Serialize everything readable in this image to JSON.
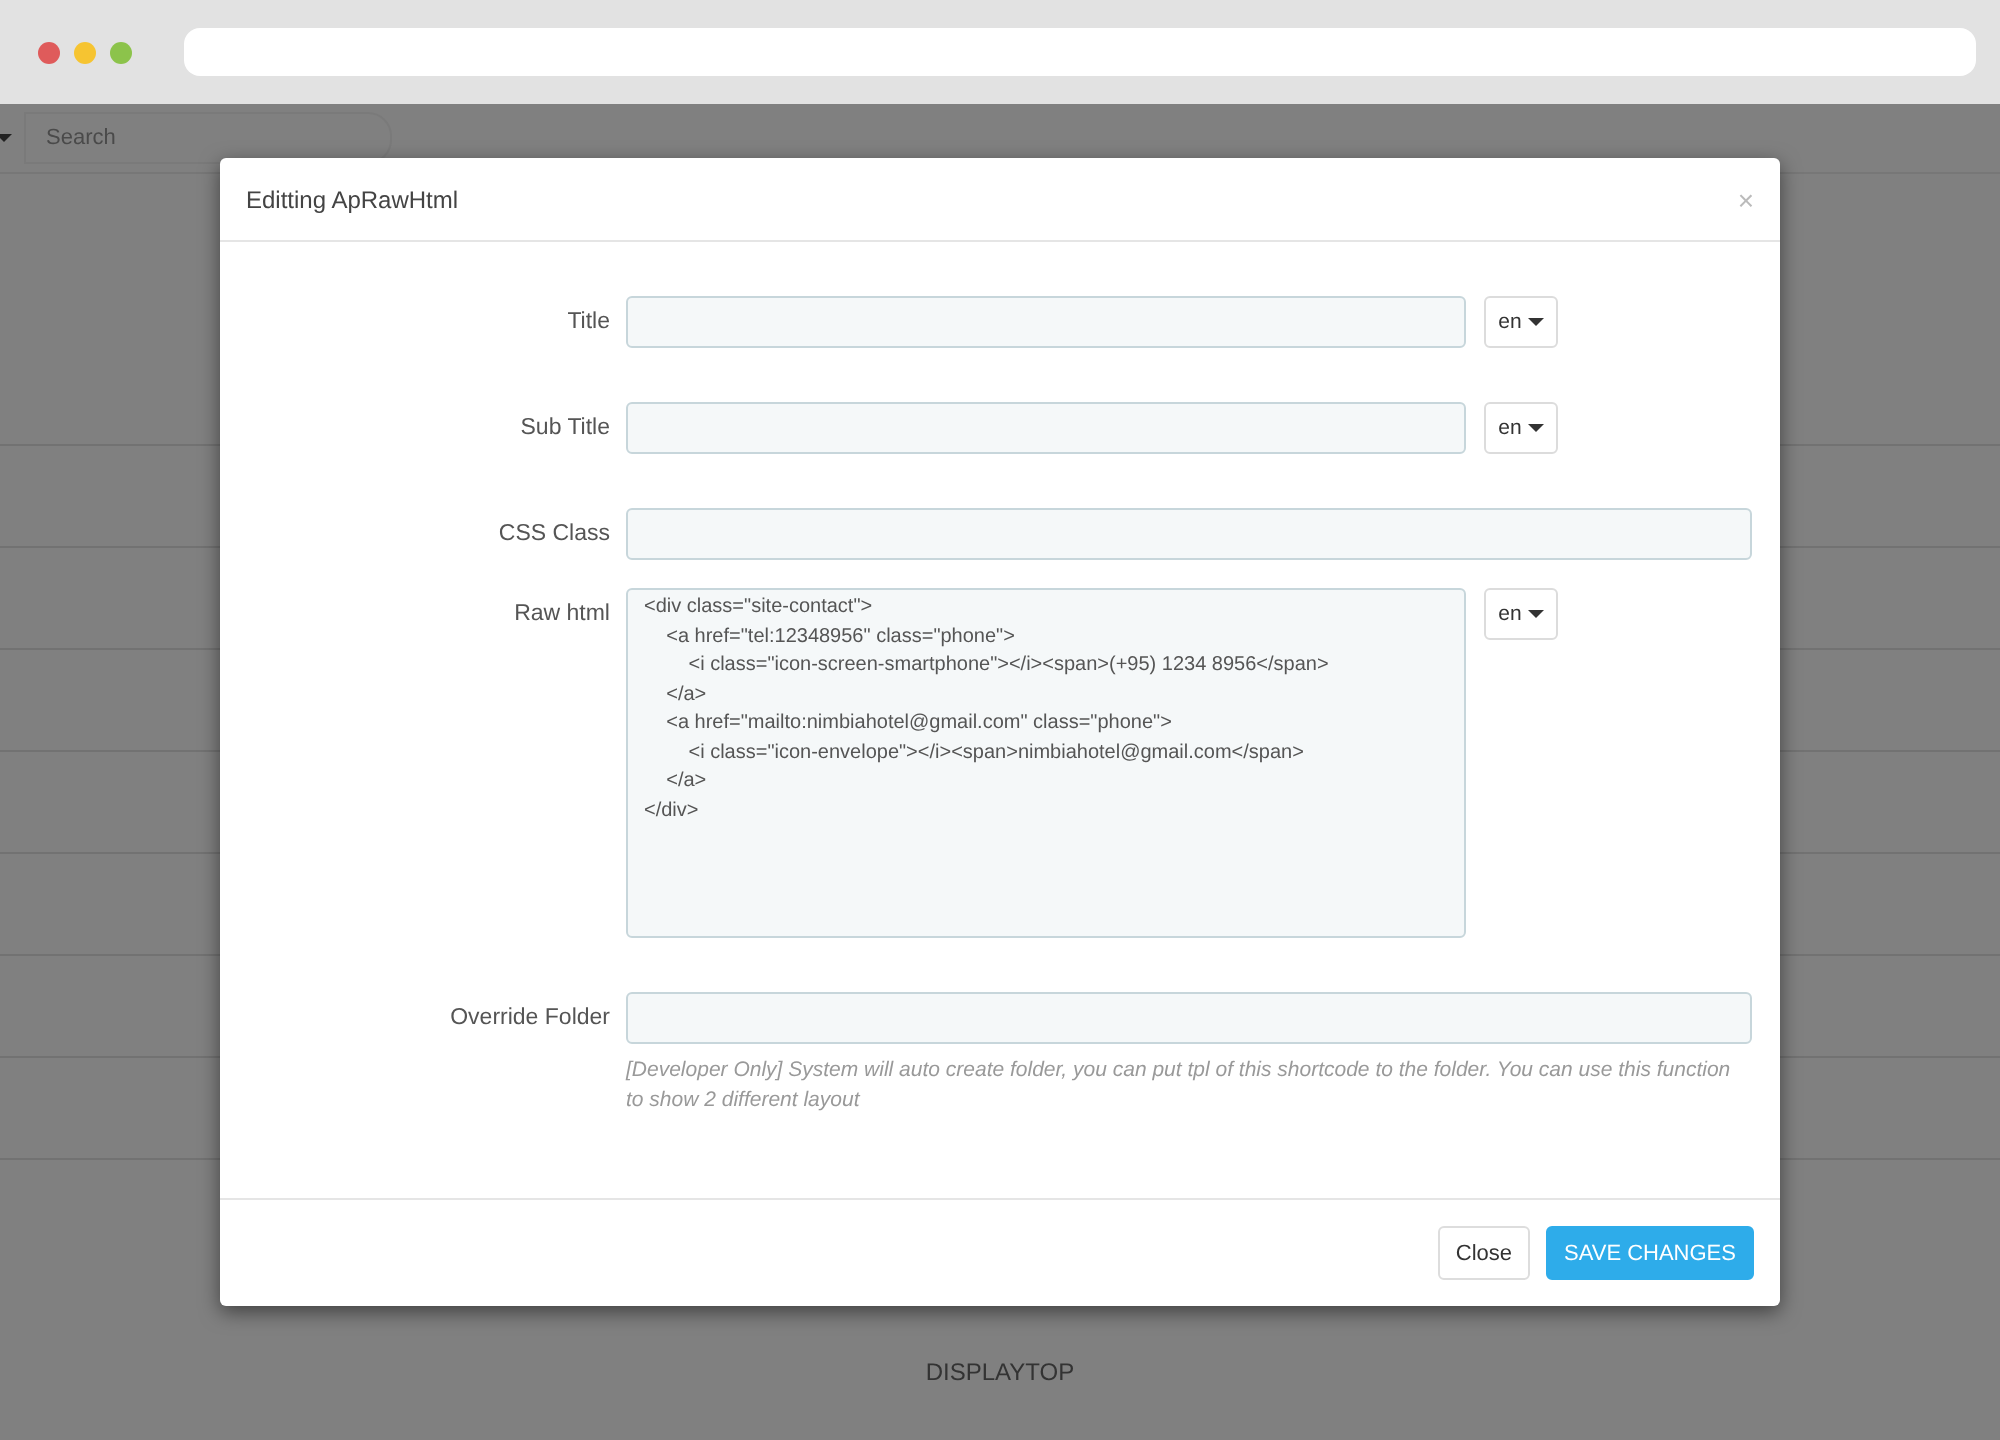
{
  "background": {
    "search": {
      "placeholder": "Search"
    },
    "section_label": "DISPLAYTOP"
  },
  "modal": {
    "title": "Editting ApRawHtml",
    "close": "×",
    "fields": [
      {
        "kind": "text",
        "label": "Title",
        "language": "en"
      },
      {
        "kind": "text",
        "label": "Sub Title",
        "language": "en"
      },
      {
        "kind": "wide",
        "label": "CSS Class"
      },
      {
        "kind": "textarea",
        "label": "Raw html",
        "language": "en",
        "value": "<div class=\"site-contact\">\n    <a href=\"tel:12348956\" class=\"phone\">\n        <i class=\"icon-screen-smartphone\"></i><span>(+95) 1234 8956</span>\n    </a>\n    <a href=\"mailto:nimbiahotel@gmail.com\" class=\"phone\">\n        <i class=\"icon-envelope\"></i><span>nimbiahotel@gmail.com</span>\n    </a>\n</div>"
      },
      {
        "kind": "wide",
        "label": "Override Folder",
        "help": "[Developer Only] System will auto create folder, you can put tpl of this shortcode to the folder. You can use this function to show 2 different layout"
      }
    ],
    "buttons": [
      {
        "kind": "default",
        "label": "Close"
      },
      {
        "kind": "primary",
        "label": "SAVE CHANGES"
      }
    ]
  }
}
